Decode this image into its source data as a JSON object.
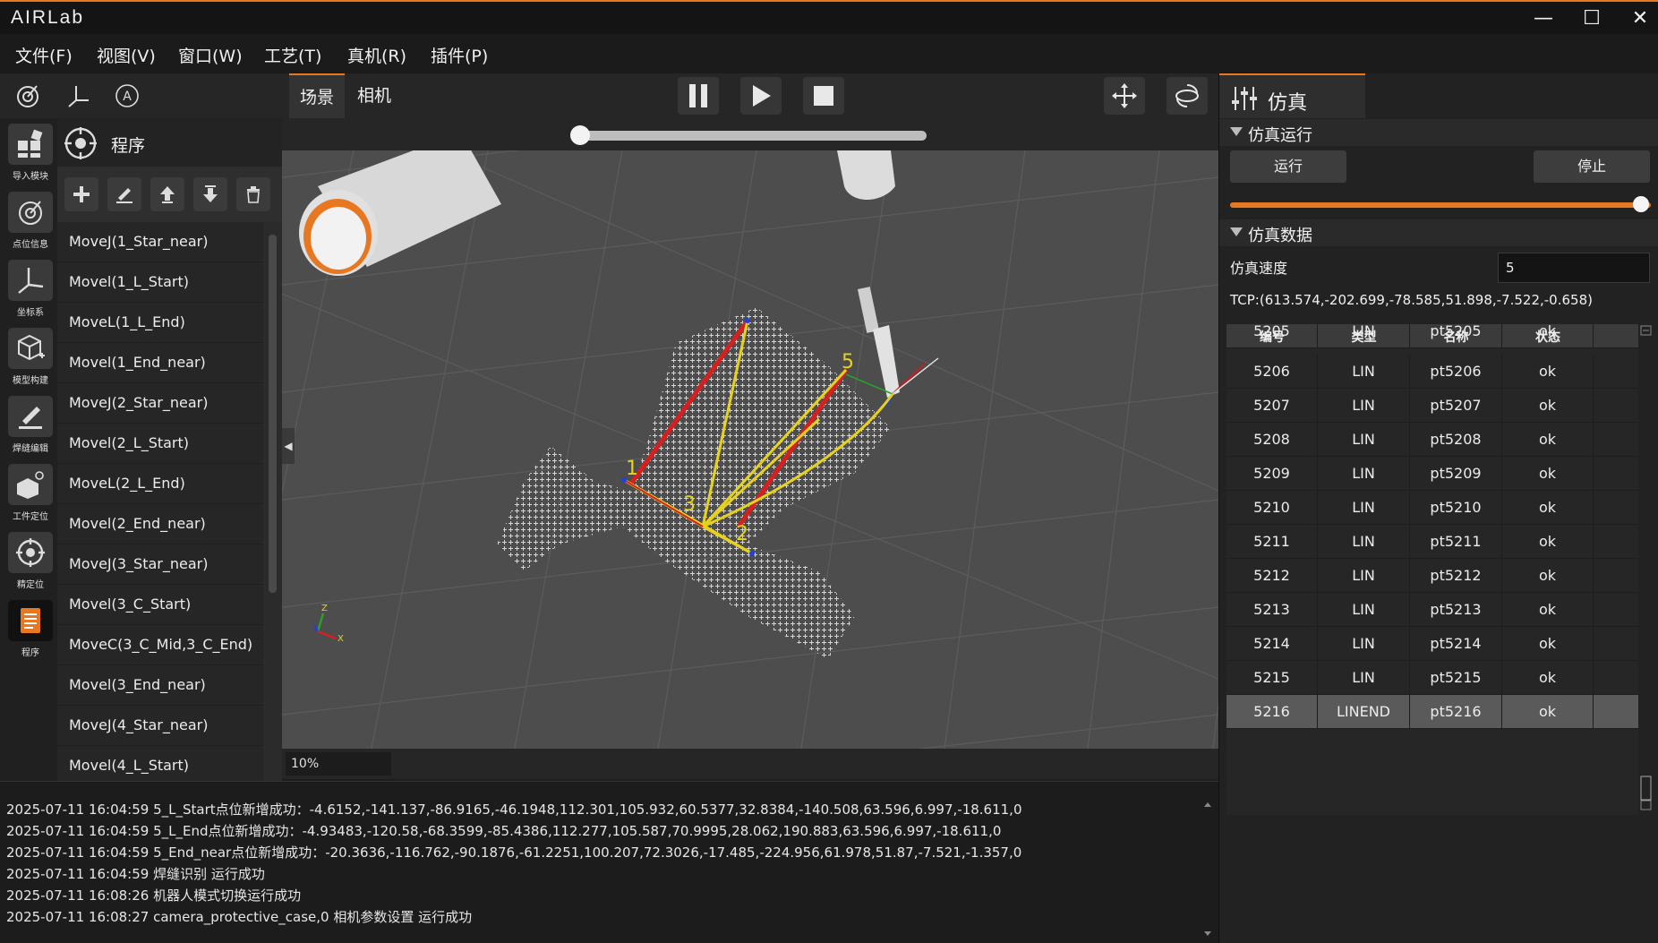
{
  "app": {
    "logo": "AIRLab"
  },
  "menu": [
    "文件(F)",
    "视图(V)",
    "窗口(W)",
    "工艺(T)",
    "真机(R)",
    "插件(P)"
  ],
  "rail": [
    {
      "label": "导入模块",
      "icon": "import-module-icon"
    },
    {
      "label": "点位信息",
      "icon": "point-info-icon"
    },
    {
      "label": "坐标系",
      "icon": "coordinate-system-icon"
    },
    {
      "label": "模型构建",
      "icon": "model-build-icon"
    },
    {
      "label": "焊缝编辑",
      "icon": "weld-edit-icon"
    },
    {
      "label": "工件定位",
      "icon": "workpiece-locate-icon"
    },
    {
      "label": "精定位",
      "icon": "fine-locate-icon"
    },
    {
      "label": "程序",
      "icon": "program-icon"
    }
  ],
  "program": {
    "title": "程序",
    "items": [
      "MoveJ(1_Star_near)",
      "Movel(1_L_Start)",
      "MoveL(1_L_End)",
      "Movel(1_End_near)",
      "MoveJ(2_Star_near)",
      "Movel(2_L_Start)",
      "MoveL(2_L_End)",
      "Movel(2_End_near)",
      "MoveJ(3_Star_near)",
      "Movel(3_C_Start)",
      "MoveC(3_C_Mid,3_C_End)",
      "Movel(3_End_near)",
      "MoveJ(4_Star_near)",
      "Movel(4_L_Start)"
    ]
  },
  "viewport": {
    "tabs": [
      "场景",
      "相机"
    ],
    "timeline_progress": 0,
    "zoom": "10%",
    "axis_labels": {
      "x": "X",
      "z": "Z"
    },
    "weld_labels": [
      "1",
      "2",
      "3",
      "5"
    ]
  },
  "log": [
    "2025-07-11 16:04:59 5_L_Start点位新增成功：-4.6152,-141.137,-86.9165,-46.1948,112.301,105.932,60.5377,32.8384,-140.508,63.596,6.997,-18.611,0",
    "2025-07-11 16:04:59 5_L_End点位新增成功：-4.93483,-120.58,-68.3599,-85.4386,112.277,105.587,70.9995,28.062,190.883,63.596,6.997,-18.611,0",
    "2025-07-11 16:04:59 5_End_near点位新增成功：-20.3636,-116.762,-90.1876,-61.2251,100.207,72.3026,-17.485,-224.956,61.978,51.87,-7.521,-1.357,0",
    "2025-07-11 16:04:59  焊缝识别 运行成功",
    "2025-07-11 16:08:26 机器人模式切换运行成功",
    "2025-07-11 16:08:27 camera_protective_case,0 相机参数设置 运行成功"
  ],
  "sim": {
    "tab": "仿真",
    "run_section": "仿真运行",
    "run_btn": "运行",
    "stop_btn": "停止",
    "speed_slider": 1.0,
    "data_section": "仿真数据",
    "speed_label": "仿真速度",
    "speed_value": "5",
    "tcp": "TCP:(613.574,-202.699,-78.585,51.898,-7.522,-0.658)",
    "columns": [
      "编号",
      "类型",
      "名称",
      "状态"
    ],
    "rows": [
      [
        "5205",
        "LIN",
        "pt5205",
        "ok"
      ],
      [
        "5206",
        "LIN",
        "pt5206",
        "ok"
      ],
      [
        "5207",
        "LIN",
        "pt5207",
        "ok"
      ],
      [
        "5208",
        "LIN",
        "pt5208",
        "ok"
      ],
      [
        "5209",
        "LIN",
        "pt5209",
        "ok"
      ],
      [
        "5210",
        "LIN",
        "pt5210",
        "ok"
      ],
      [
        "5211",
        "LIN",
        "pt5211",
        "ok"
      ],
      [
        "5212",
        "LIN",
        "pt5212",
        "ok"
      ],
      [
        "5213",
        "LIN",
        "pt5213",
        "ok"
      ],
      [
        "5214",
        "LIN",
        "pt5214",
        "ok"
      ],
      [
        "5215",
        "LIN",
        "pt5215",
        "ok"
      ],
      [
        "5216",
        "LINEND",
        "pt5216",
        "ok"
      ]
    ]
  },
  "colors": {
    "accent": "#e87722",
    "weld_path": "#e6d21c",
    "weld_seam": "#d62020"
  }
}
